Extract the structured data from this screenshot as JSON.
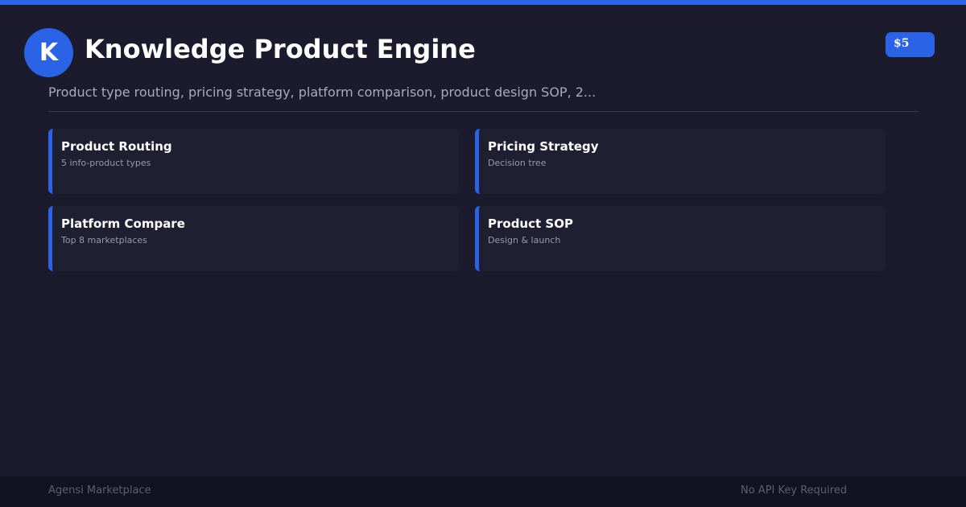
{
  "colors": {
    "accent": "#2a63e6",
    "background": "#1b1b2d",
    "card_background": "#1f1f32",
    "footer_background": "#121220"
  },
  "header": {
    "logo_letter": "K",
    "title": "Knowledge Product Engine",
    "price": "$5",
    "subtitle": "Product type routing, pricing strategy, platform comparison, product design SOP, 2..."
  },
  "cards": [
    {
      "title": "Product Routing",
      "description": "5 info-product types"
    },
    {
      "title": "Pricing Strategy",
      "description": "Decision tree"
    },
    {
      "title": "Platform Compare",
      "description": "Top 8 marketplaces"
    },
    {
      "title": "Product SOP",
      "description": "Design & launch"
    }
  ],
  "footer": {
    "brand": "Agensi Marketplace",
    "note": "No API Key Required"
  }
}
